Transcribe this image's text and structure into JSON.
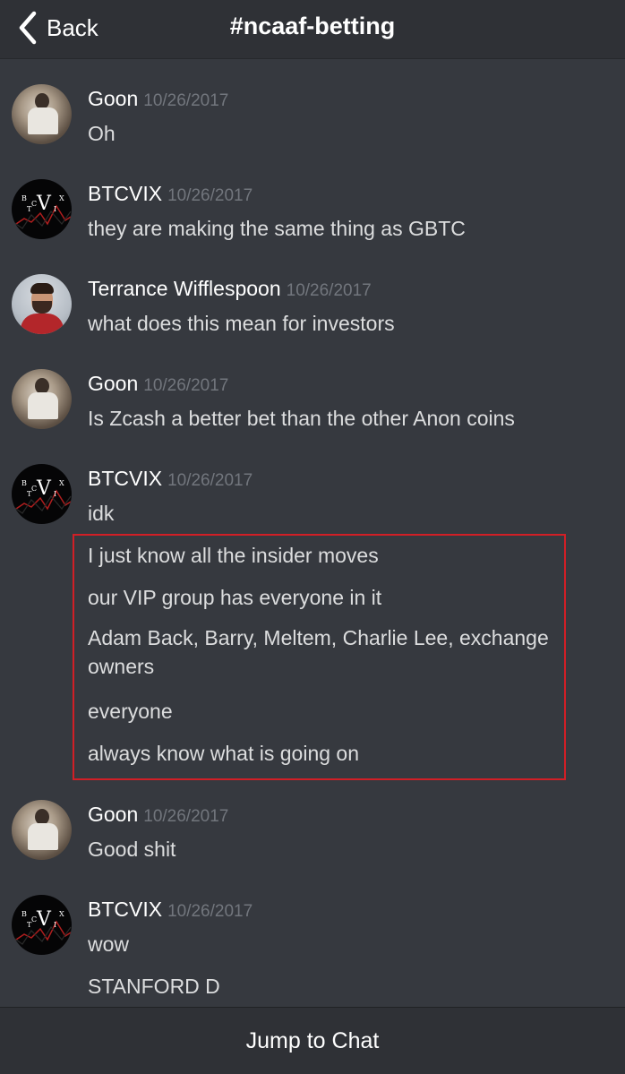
{
  "header": {
    "back_label": "Back",
    "back_icon": "chevron-left-icon",
    "channel": "#ncaaf-betting"
  },
  "messages": [
    {
      "user": "Goon",
      "timestamp": "10/26/2017",
      "avatar": "goon-avatar",
      "lines": [
        "Oh"
      ]
    },
    {
      "user": "BTCVIX",
      "timestamp": "10/26/2017",
      "avatar": "btcvix-avatar",
      "avatar_text": [
        "B",
        "T",
        "C",
        "V",
        "I",
        "X"
      ],
      "lines": [
        "they are making the same thing as GBTC"
      ]
    },
    {
      "user": "Terrance Wifflespoon",
      "timestamp": "10/26/2017",
      "avatar": "terrance-avatar",
      "lines": [
        "what does this mean for investors"
      ]
    },
    {
      "user": "Goon",
      "timestamp": "10/26/2017",
      "avatar": "goon-avatar",
      "lines": [
        "Is Zcash a better bet than the other Anon coins"
      ]
    },
    {
      "user": "BTCVIX",
      "timestamp": "10/26/2017",
      "avatar": "btcvix-avatar",
      "lines": [
        "idk",
        "I just know all the insider moves",
        "our VIP group has everyone in it",
        "Adam Back, Barry, Meltem, Charlie Lee, exchange owners",
        "everyone",
        "always know what is going on"
      ]
    },
    {
      "user": "Goon",
      "timestamp": "10/26/2017",
      "avatar": "goon-avatar",
      "lines": [
        "Good shit"
      ]
    },
    {
      "user": "BTCVIX",
      "timestamp": "10/26/2017",
      "avatar": "btcvix-avatar",
      "lines": [
        "wow",
        "STANFORD D"
      ]
    }
  ],
  "highlight_color": "#d11f26",
  "footer": {
    "jump_label": "Jump to Chat"
  }
}
